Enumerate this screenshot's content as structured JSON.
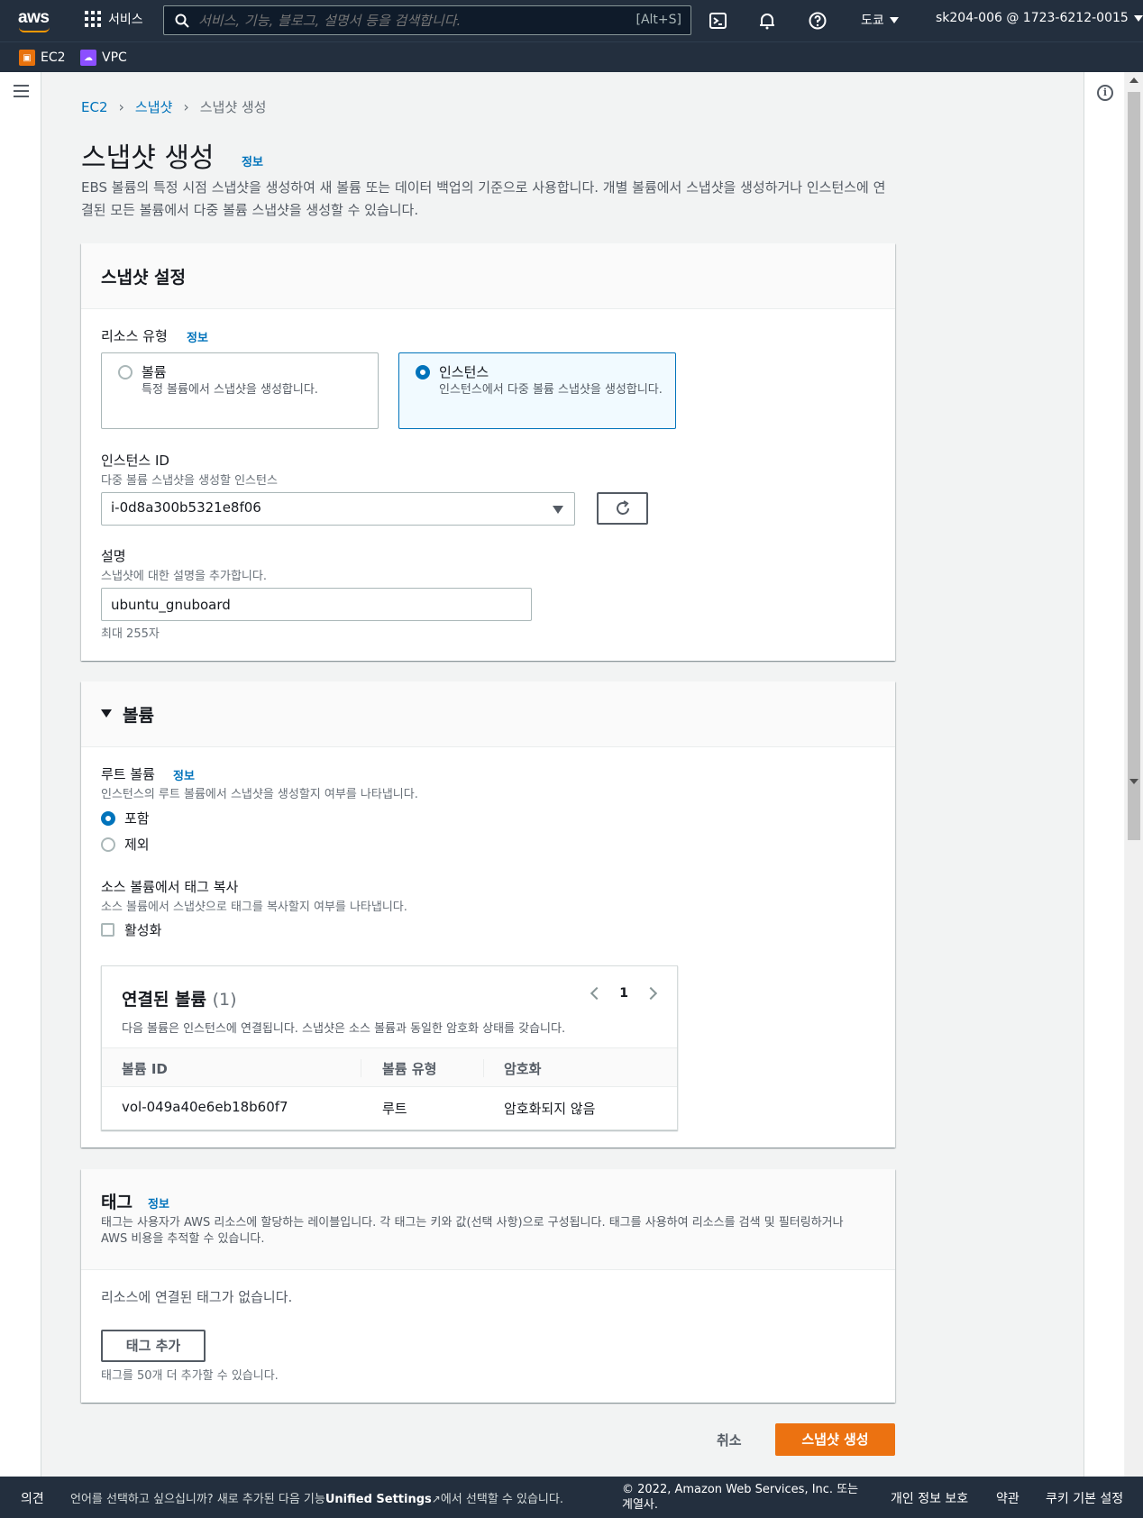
{
  "nav": {
    "logo": "aws",
    "services_label": "서비스",
    "search_placeholder": "서비스, 기능, 블로그, 설명서 등을 검색합니다.",
    "search_shortcut": "[Alt+S]",
    "region": "도쿄",
    "account": "sk204-006 @ 1723-6212-0015"
  },
  "favorites": [
    {
      "label": "EC2",
      "color": "#e8720c"
    },
    {
      "label": "VPC",
      "color": "#8c4fff"
    }
  ],
  "breadcrumb": {
    "items": [
      "EC2",
      "스냅샷",
      "스냅샷 생성"
    ]
  },
  "page": {
    "title": "스냅샷 생성",
    "info": "정보",
    "description": "EBS 볼륨의 특정 시점 스냅샷을 생성하여 새 볼륨 또는 데이터 백업의 기준으로 사용합니다. 개별 볼륨에서 스냅샷을 생성하거나 인스턴스에 연결된 모든 볼륨에서 다중 볼륨 스냅샷을 생성할 수 있습니다."
  },
  "snapshot_settings": {
    "title": "스냅샷 설정",
    "resource_type_label": "리소스 유형",
    "resource_type_info": "정보",
    "options": [
      {
        "title": "볼륨",
        "desc": "특정 볼륨에서 스냅샷을 생성합니다."
      },
      {
        "title": "인스턴스",
        "desc": "인스턴스에서 다중 볼륨 스냅샷을 생성합니다."
      }
    ],
    "instance_id_label": "인스턴스 ID",
    "instance_id_desc": "다중 볼륨 스냅샷을 생성할 인스턴스",
    "instance_id_value": "i-0d8a300b5321e8f06",
    "description_label": "설명",
    "description_desc": "스냅샷에 대한 설명을 추가합니다.",
    "description_value": "ubuntu_gnuboard",
    "description_constraint": "최대 255자"
  },
  "volumes": {
    "title": "볼륨",
    "root_label": "루트 볼륨",
    "root_info": "정보",
    "root_desc": "인스턴스의 루트 볼륨에서 스냅샷을 생성할지 여부를 나타냅니다.",
    "root_options": [
      "포함",
      "제외"
    ],
    "copy_tags_label": "소스 볼륨에서 태그 복사",
    "copy_tags_desc": "소스 볼륨에서 스냅샷으로 태그를 복사할지 여부를 나타냅니다.",
    "copy_tags_checkbox": "활성화",
    "table": {
      "title": "연결된 볼륨",
      "count": "(1)",
      "page": "1",
      "desc": "다음 볼륨은 인스턴스에 연결됩니다. 스냅샷은 소스 볼륨과 동일한 암호화 상태를 갖습니다.",
      "columns": [
        "볼륨 ID",
        "볼륨 유형",
        "암호화"
      ],
      "rows": [
        [
          "vol-049a40e6eb18b60f7",
          "루트",
          "암호화되지 않음"
        ]
      ]
    }
  },
  "tags": {
    "title": "태그",
    "info": "정보",
    "desc": "태그는 사용자가 AWS 리소스에 할당하는 레이블입니다. 각 태그는 키와 값(선택 사항)으로 구성됩니다. 태그를 사용하여 리소스를 검색 및 필터링하거나 AWS 비용을 추적할 수 있습니다.",
    "empty": "리소스에 연결된 태그가 없습니다.",
    "add_button": "태그 추가",
    "limit": "태그를 50개 더 추가할 수 있습니다."
  },
  "actions": {
    "cancel": "취소",
    "create": "스냅샷 생성"
  },
  "footer": {
    "feedback": "의견",
    "language_prefix": "언어를 선택하고 싶으십니까? 새로 추가된 다음 기능",
    "unified_settings": "Unified Settings",
    "language_suffix": "에서 선택할 수 있습니다.",
    "copyright": "© 2022, Amazon Web Services, Inc. 또는 계열사.",
    "privacy": "개인 정보 보호",
    "terms": "약관",
    "cookies": "쿠키 기본 설정"
  },
  "colors": {
    "accent": "#0073bb",
    "primary_button": "#ec7211",
    "nav_bg": "#232f3e"
  }
}
